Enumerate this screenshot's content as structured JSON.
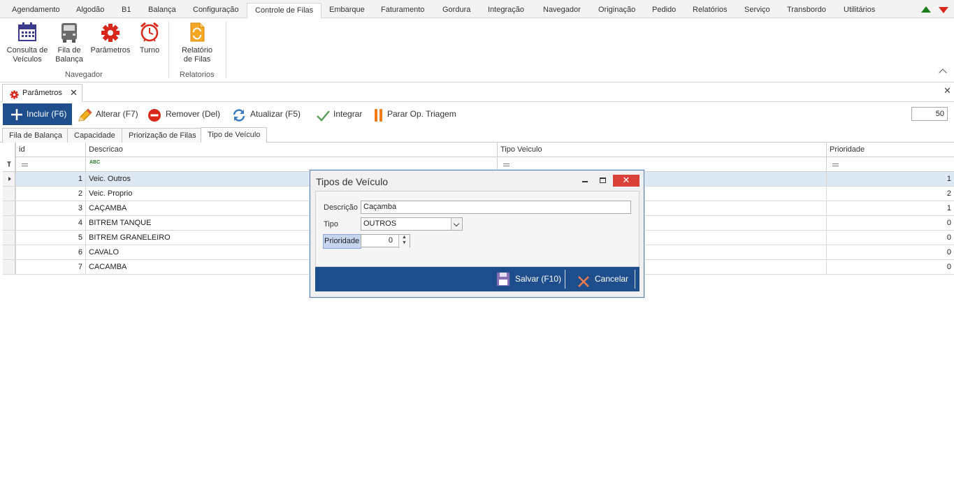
{
  "ribbon": {
    "tabs": [
      "Agendamento",
      "Algodão",
      "B1",
      "Balança",
      "Configuração",
      "Controle de Filas",
      "Embarque",
      "Faturamento",
      "Gordura",
      "Integração",
      "Navegador",
      "Originação",
      "Pedido",
      "Relatórios",
      "Serviço",
      "Transbordo",
      "Utilitários"
    ],
    "active_tab": "Controle de Filas",
    "buttons": {
      "consulta_line1": "Consulta de",
      "consulta_line2": "Veículos",
      "fila_line1": "Fila de",
      "fila_line2": "Balança",
      "parametros": "Parâmetros",
      "turno": "Turno",
      "relatorio_line1": "Relatório",
      "relatorio_line2": "de Filas"
    },
    "groups": {
      "navegador": "Navegador",
      "relatorios": "Relatorios"
    }
  },
  "document_tab": {
    "label": "Parâmetros"
  },
  "toolbar": {
    "incluir": "Incluir (F6)",
    "alterar": "Alterar (F7)",
    "remover": "Remover (Del)",
    "atualizar": "Atualizar (F5)",
    "integrar": "Integrar",
    "parar": "Parar Op. Triagem",
    "page_size": "50"
  },
  "subtabs": [
    "Fila de Balança",
    "Capacidade",
    "Priorização de Filas",
    "Tipo de Veículo"
  ],
  "grid": {
    "columns": {
      "id": "id",
      "descricao": "Descricao",
      "tipo": "Tipo Veiculo",
      "prioridade": "Prioridade"
    },
    "filter_text_icon": "ABC",
    "rows": [
      {
        "id": "1",
        "descricao": "Veic. Outros",
        "prioridade": "1"
      },
      {
        "id": "2",
        "descricao": "Veic. Proprio",
        "prioridade": "2"
      },
      {
        "id": "3",
        "descricao": "CAÇAMBA",
        "prioridade": "1"
      },
      {
        "id": "4",
        "descricao": "BITREM TANQUE",
        "prioridade": "0"
      },
      {
        "id": "5",
        "descricao": "BITREM GRANELEIRO",
        "prioridade": "0"
      },
      {
        "id": "6",
        "descricao": "CAVALO",
        "prioridade": "0"
      },
      {
        "id": "7",
        "descricao": "CACAMBA",
        "prioridade": "0"
      }
    ]
  },
  "dialog": {
    "title": "Tipos de Veículo",
    "descricao_label": "Descrição",
    "descricao_value": "Caçamba",
    "tipo_label": "Tipo",
    "tipo_value": "OUTROS",
    "prioridade_label": "Prioridade",
    "prioridade_value": "0",
    "salvar": "Salvar (F10)",
    "cancelar": "Cancelar"
  },
  "colors": {
    "accent_blue": "#1f4e8c",
    "selected_row": "#dde8f5",
    "close_red": "#d9413a"
  }
}
